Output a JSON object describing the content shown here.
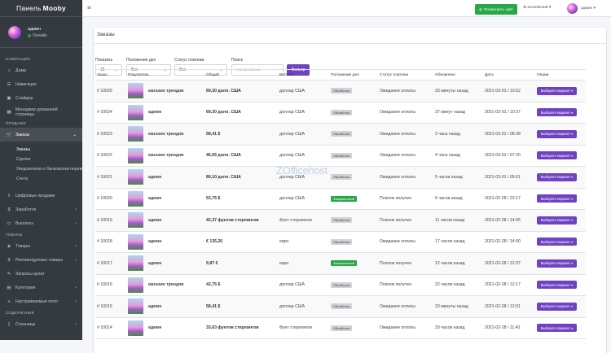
{
  "sidebar": {
    "brand_prefix": "Панель",
    "brand_name": "Mooby",
    "user_name": "админ",
    "user_status": "Онлайн",
    "sections": {
      "navigation": "НАВИГАЦИЯ",
      "sales": "ПРОДАЖИ",
      "products": "ТОВАРЫ",
      "content": "СОДЕРЖАНИЕ"
    },
    "items": {
      "home": "Дома",
      "navigation": "Навигация",
      "slider": "Слайдер",
      "homepage_manager": "Менеджер домашней страницы",
      "orders": "Заказы",
      "orders_sub": "Заказы",
      "transactions": "Сделки",
      "bank_notifications": "Уведомления о банковском переводе",
      "invoices": "Счета",
      "digital_sales": "Цифровые продажи",
      "earnings": "Заработок",
      "payouts": "Выплаты",
      "products": "Товары",
      "featured": "Рекомендуемые товары",
      "quote_requests": "Запросы цитат",
      "categories": "Категории",
      "custom_fields": "Настраиваемые поля",
      "pages": "Страницы"
    }
  },
  "topbar": {
    "view_site": "Посмотреть сайт",
    "language": "английский",
    "user": "админ"
  },
  "page": {
    "title": "Заказы"
  },
  "filters": {
    "show_label": "Показать",
    "show_value": "15",
    "state_label": "Положение дел",
    "state_value": "Все",
    "payment_label": "Статус платежа",
    "payment_value": "Все",
    "search_label": "Поиск",
    "search_placeholder": "Номер заказа",
    "filter_button": "Фильтр"
  },
  "table": {
    "headers": [
      "Заказ",
      "Покупатель",
      "Общий",
      "Валюта",
      "Положение дел",
      "Статус платежа",
      "Обновлено",
      "Дата",
      "Опции"
    ],
    "option_button": "Выберите вариант",
    "rows": [
      {
        "id": "# 10025",
        "buyer": "магазин трендов",
        "total": "69,30 долл. США",
        "currency": "доллар США",
        "state": "Обработка",
        "state_done": false,
        "payment": "Ожидание оплаты",
        "updated": "33 минуты назад",
        "date": "2021-03-01 / 10:52"
      },
      {
        "id": "# 10024",
        "buyer": "админ",
        "total": "69,30 долл. США",
        "currency": "доллар США",
        "state": "Обработка",
        "state_done": false,
        "payment": "Ожидание оплаты",
        "updated": "37 минут назад",
        "date": "2021-03-01 / 10:37"
      },
      {
        "id": "# 10023",
        "buyer": "магазин трендов",
        "total": "58,41 $",
        "currency": "доллар США",
        "state": "Обработка",
        "state_done": false,
        "payment": "Ожидание оплаты",
        "updated": "3 часа назад",
        "date": "2021-03-01 / 08:38"
      },
      {
        "id": "# 10022",
        "buyer": "магазин трендов",
        "total": "46,65 долл. США",
        "currency": "доллар США",
        "state": "Обработка",
        "state_done": false,
        "payment": "Ожидание оплаты",
        "updated": "4 часа назад",
        "date": "2021-03-01 / 07:20"
      },
      {
        "id": "# 10021",
        "buyer": "админ",
        "total": "80,10 долл. США",
        "currency": "доллар США",
        "state": "Обработка",
        "state_done": false,
        "payment": "Ожидание оплаты",
        "updated": "5 часов назад",
        "date": "2021-03-01 / 05:01"
      },
      {
        "id": "# 10020",
        "buyer": "админ",
        "total": "53,75 $",
        "currency": "доллар США",
        "state": "Завершенный",
        "state_done": true,
        "payment": "Платеж получен",
        "updated": "6 часов назад",
        "date": "2021-02-28 / 23:17"
      },
      {
        "id": "# 10019",
        "buyer": "админ",
        "total": "42,37 фунтов стерлингов",
        "currency": "Фунт стерлингов",
        "state": "Обработка",
        "state_done": false,
        "payment": "Платеж получен",
        "updated": "11 часов назад",
        "date": "2021-02-28 / 14:05"
      },
      {
        "id": "# 10018",
        "buyer": "админ",
        "total": "€ 135,26",
        "currency": "евро",
        "state": "Обработка",
        "state_done": false,
        "payment": "Ожидание оплаты",
        "updated": "17 часов назад",
        "date": "2021-02-28 / 14:00"
      },
      {
        "id": "# 10017",
        "buyer": "админ",
        "total": "9,87 €",
        "currency": "евро",
        "state": "Завершенный",
        "state_done": true,
        "payment": "Платеж получен",
        "updated": "12 часов назад",
        "date": "2021-02-28 / 12:37"
      },
      {
        "id": "# 10016",
        "buyer": "магазин трендов",
        "total": "42,75 $",
        "currency": "доллар США",
        "state": "Обработка",
        "state_done": false,
        "payment": "Платеж получен",
        "updated": "22 часов назад",
        "date": "2021-02-28 / 12:17"
      },
      {
        "id": "# 10015",
        "buyer": "админ",
        "total": "58,41 $",
        "currency": "доллар США",
        "state": "Обработка",
        "state_done": false,
        "payment": "Ожидание оплаты",
        "updated": "23 минуты назад",
        "date": "2021-02-28 / 12:01"
      },
      {
        "id": "# 10014",
        "buyer": "админ",
        "total": "33,63 фунтов стерлингов",
        "currency": "Фунт стерлингов",
        "state": "Обработка",
        "state_done": false,
        "payment": "Ожидание оплаты",
        "updated": "33 часов назад",
        "date": "2021-02-28 / 11:42"
      }
    ]
  },
  "watermark": "ZOfficehost"
}
